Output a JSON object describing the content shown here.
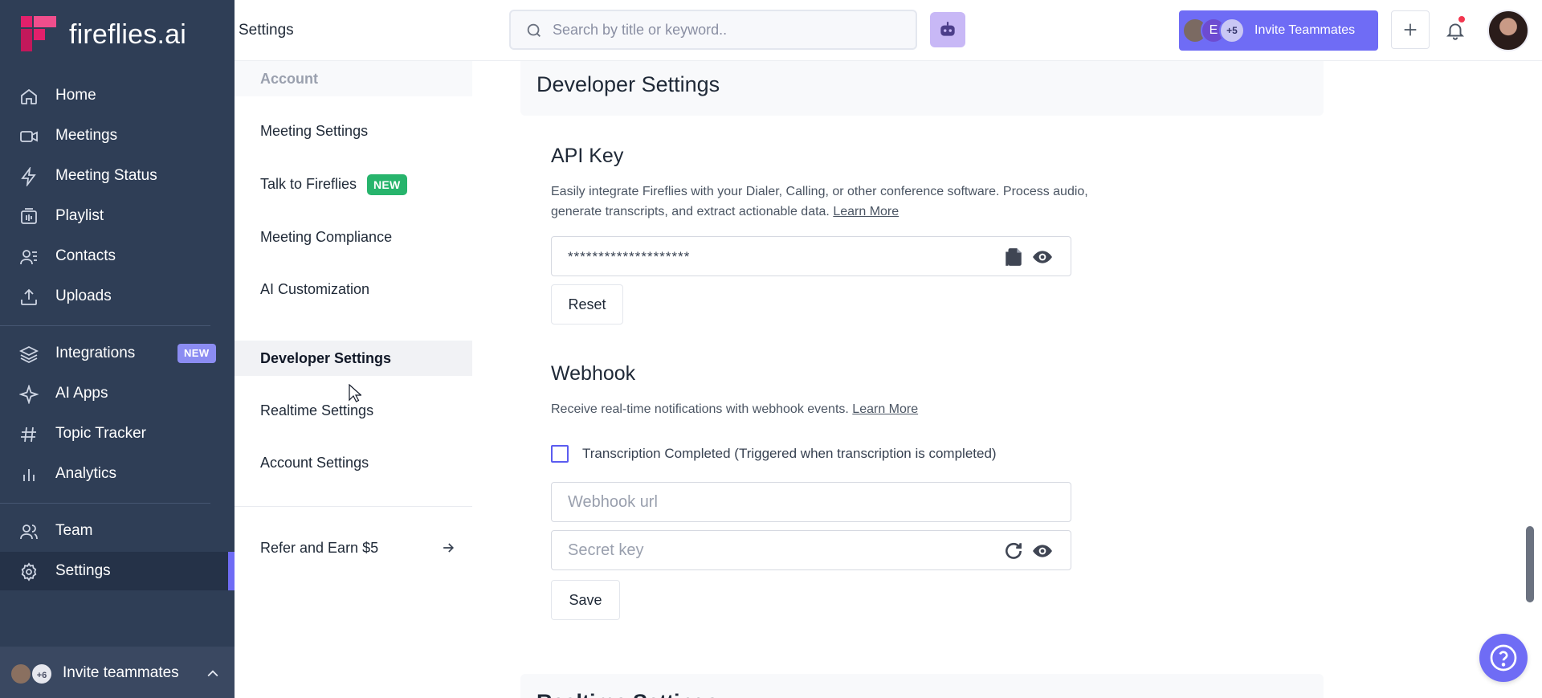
{
  "brand": {
    "name": "fireflies.ai"
  },
  "sidebar": {
    "items": [
      {
        "label": "Home",
        "icon": "home-icon"
      },
      {
        "label": "Meetings",
        "icon": "video-camera-icon"
      },
      {
        "label": "Meeting Status",
        "icon": "lightning-icon"
      },
      {
        "label": "Playlist",
        "icon": "playlist-icon"
      },
      {
        "label": "Contacts",
        "icon": "contacts-icon"
      },
      {
        "label": "Uploads",
        "icon": "upload-icon"
      },
      {
        "label": "Integrations",
        "icon": "layers-icon",
        "badge": "NEW"
      },
      {
        "label": "AI Apps",
        "icon": "sparkle-icon"
      },
      {
        "label": "Topic Tracker",
        "icon": "hashtag-icon"
      },
      {
        "label": "Analytics",
        "icon": "bar-chart-icon"
      },
      {
        "label": "Team",
        "icon": "team-icon"
      },
      {
        "label": "Settings",
        "icon": "gear-icon",
        "active": true
      }
    ],
    "footer": {
      "count": "+6",
      "label": "Invite teammates"
    }
  },
  "topbar": {
    "title": "Settings",
    "search_placeholder": "Search by title or keyword..",
    "invite": {
      "avatar_letter": "E",
      "extra_count": "+5",
      "label": "Invite Teammates"
    }
  },
  "settings_nav": {
    "header": "Account",
    "items": [
      {
        "label": "Meeting Settings"
      },
      {
        "label": "Talk to Fireflies",
        "badge": "NEW"
      },
      {
        "label": "Meeting Compliance"
      },
      {
        "label": "AI Customization"
      },
      {
        "label": "Developer Settings",
        "active": true
      },
      {
        "label": "Realtime Settings"
      },
      {
        "label": "Account Settings"
      }
    ],
    "refer": "Refer and Earn $5"
  },
  "developer": {
    "section_title": "Developer Settings",
    "api_key": {
      "title": "API Key",
      "description": "Easily integrate Fireflies with your Dialer, Calling, or other conference software. Process audio, generate transcripts, and extract actionable data.",
      "learn_more": "Learn More",
      "masked_value": "********************",
      "reset_label": "Reset"
    },
    "webhook": {
      "title": "Webhook",
      "description": "Receive real-time notifications with webhook events.",
      "learn_more": "Learn More",
      "checkbox_label": "Transcription Completed (Triggered when transcription is completed)",
      "url_placeholder": "Webhook url",
      "secret_placeholder": "Secret key",
      "save_label": "Save"
    }
  },
  "next_section": {
    "title": "Realtime Settings"
  },
  "colors": {
    "sidebar_bg": "#2f3e56",
    "accent": "#6f6cf5",
    "new_badge_green": "#27b46c",
    "brand_pink": "#e3206b"
  }
}
